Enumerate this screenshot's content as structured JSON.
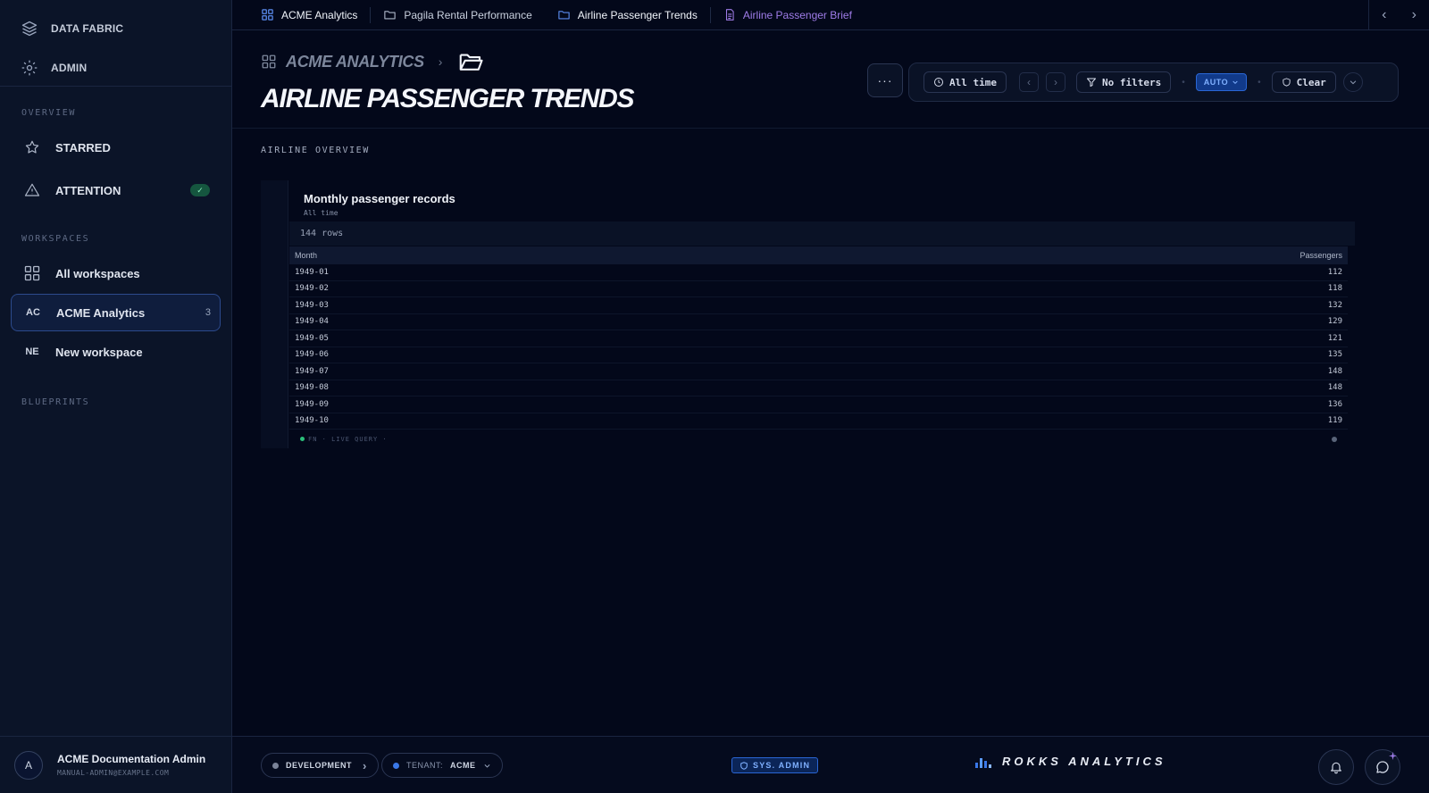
{
  "sidebar": {
    "top_items": [
      {
        "label": "DATA FABRIC",
        "icon": "layers-icon"
      },
      {
        "label": "ADMIN",
        "icon": "gear-icon"
      }
    ],
    "sections": {
      "overview": "OVERVIEW",
      "workspaces": "WORKSPACES",
      "blueprints": "BLUEPRINTS"
    },
    "overview_items": [
      {
        "label": "STARRED",
        "icon": "star-icon"
      },
      {
        "label": "ATTENTION",
        "icon": "warning-icon",
        "badge": "✓"
      }
    ],
    "workspace_items": [
      {
        "label": "All workspaces",
        "icon": "grid-icon"
      },
      {
        "abbr": "AC",
        "label": "ACME Analytics",
        "count": "3",
        "active": true
      },
      {
        "abbr": "NE",
        "label": "New workspace"
      }
    ],
    "user": {
      "initial": "A",
      "name": "ACME Documentation Admin",
      "email": "MANUAL-ADMIN@EXAMPLE.COM"
    }
  },
  "tabs": [
    {
      "label": "ACME Analytics",
      "icon": "grid-icon"
    },
    {
      "label": "Pagila Rental Performance",
      "icon": "folder-icon"
    },
    {
      "label": "Airline Passenger Trends",
      "icon": "folder-icon"
    },
    {
      "label": "Airline Passenger Brief",
      "icon": "document-icon",
      "color": "#9f7ce8"
    }
  ],
  "header": {
    "breadcrumb": "ACME ANALYTICS",
    "title": "AIRLINE PASSENGER TRENDS",
    "more": "···"
  },
  "filters": {
    "time": "All time",
    "filters": "No filters",
    "auto": "AUTO",
    "clear": "Clear"
  },
  "content": {
    "section_label": "AIRLINE OVERVIEW",
    "card": {
      "title": "Monthly passenger records",
      "subtitle": "All time",
      "row_count": "144 rows",
      "columns": [
        "Month",
        "Passengers"
      ],
      "rows": [
        [
          "1949-01",
          "112"
        ],
        [
          "1949-02",
          "118"
        ],
        [
          "1949-03",
          "132"
        ],
        [
          "1949-04",
          "129"
        ],
        [
          "1949-05",
          "121"
        ],
        [
          "1949-06",
          "135"
        ],
        [
          "1949-07",
          "148"
        ],
        [
          "1949-08",
          "148"
        ],
        [
          "1949-09",
          "136"
        ],
        [
          "1949-10",
          "119"
        ]
      ],
      "footer": "FN · LIVE QUERY ·"
    }
  },
  "bottom_bar": {
    "environment": "DEVELOPMENT",
    "tenant_label": "TENANT:",
    "tenant_value": "ACME",
    "role": "SYS. ADMIN",
    "brand": "ROKKS ANALYTICS"
  },
  "colors": {
    "background": "#03081a",
    "sidebar": "#0b1428",
    "accent_blue": "#2a66d4",
    "accent_purple": "#9f7ce8",
    "success_green": "#2bbf7a"
  }
}
